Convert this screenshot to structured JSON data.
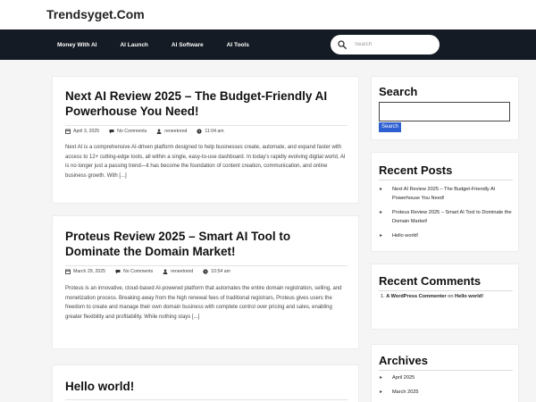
{
  "site": {
    "title": "Trendsyget.Com"
  },
  "nav": {
    "items": [
      "Money With AI",
      "AI Launch",
      "AI Software",
      "AI Tools"
    ],
    "search_placeholder": "Search"
  },
  "posts": [
    {
      "title": "Next AI Review 2025 – The Budget-Friendly AI Powerhouse You Need!",
      "date": "April 3, 2025",
      "comments": "No Comments",
      "author": "reneetrend",
      "time": "11:04 am",
      "excerpt": "Next AI is a comprehensive AI-driven platform designed to help businesses create, automate, and expand faster with access to 12+ cutting-edge tools, all within a single, easy-to-use dashboard. In today's rapidly evolving digital world, AI is no longer just a passing trend—it has become the foundation of content creation, communication, and online business growth. With [...]"
    },
    {
      "title": "Proteus Review 2025 – Smart AI Tool to Dominate the Domain Market!",
      "date": "March 29, 2025",
      "comments": "No Comments",
      "author": "reneetrend",
      "time": "10:54 am",
      "excerpt": "Proteus is an innovative, cloud-based AI-powered platform that automates the entire domain registration, selling, and monetization process. Breaking away from the high renewal fees of traditional registrars, Proteus gives users the freedom to create and manage their own domain business with complete control over pricing and sales, enabling greater flexibility and profitability. While nothing stays [...]"
    },
    {
      "title": "Hello world!"
    }
  ],
  "sidebar": {
    "search": {
      "title": "Search",
      "button": "Search"
    },
    "recent_posts": {
      "title": "Recent Posts",
      "items": [
        "Next AI Review 2025 – The Budget-Friendly AI Powerhouse You Need!",
        "Proteus Review 2025 – Smart AI Tool to Dominate the Domain Market!",
        "Hello world!"
      ]
    },
    "recent_comments": {
      "title": "Recent Comments",
      "number": "1.",
      "author": "A WordPress Commenter",
      "on": "on",
      "post": "Hello world!"
    },
    "archives": {
      "title": "Archives",
      "items": [
        "April 2025",
        "March 2025"
      ]
    }
  },
  "colors": {
    "nav_bg": "#141b24",
    "button_bg": "#2e5fd1"
  },
  "icons": {
    "nav_search": "search-icon",
    "meta_date": "calendar-icon",
    "meta_comments": "comment-icon",
    "meta_author": "user-icon",
    "meta_time": "clock-icon"
  }
}
